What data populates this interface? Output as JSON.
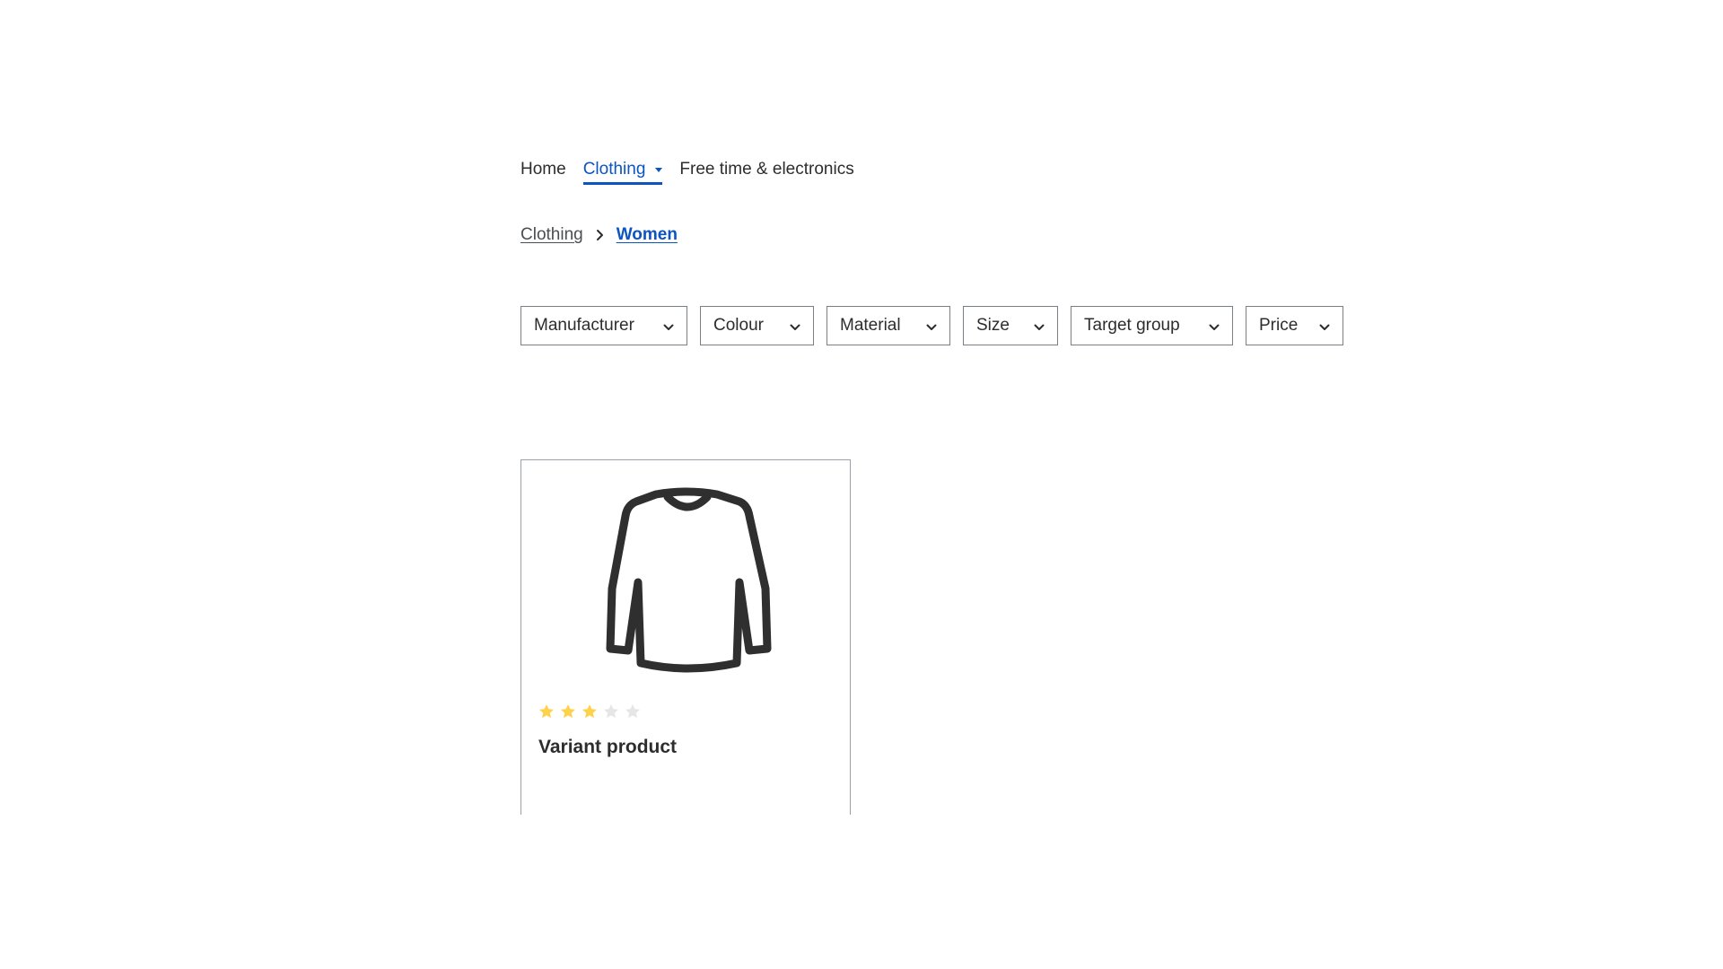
{
  "nav": {
    "items": [
      {
        "label": "Home",
        "active": false
      },
      {
        "label": "Clothing",
        "active": true,
        "has_dropdown": true
      },
      {
        "label": "Free time & electronics",
        "active": false
      }
    ]
  },
  "breadcrumb": {
    "items": [
      {
        "label": "Clothing"
      },
      {
        "label": "Women",
        "current": true
      }
    ]
  },
  "filters": {
    "items": [
      {
        "label": "Manufacturer"
      },
      {
        "label": "Colour"
      },
      {
        "label": "Material"
      },
      {
        "label": "Size"
      },
      {
        "label": "Target group"
      },
      {
        "label": "Price"
      }
    ]
  },
  "products": [
    {
      "name": "Variant product",
      "rating": 3,
      "rating_max": 5,
      "image_icon": "long-sleeve-shirt-icon"
    }
  ],
  "colors": {
    "accent": "#0b54c2",
    "text": "#2d2d2d",
    "star_filled": "#ffd24d",
    "star_empty": "#e6e6e6"
  }
}
